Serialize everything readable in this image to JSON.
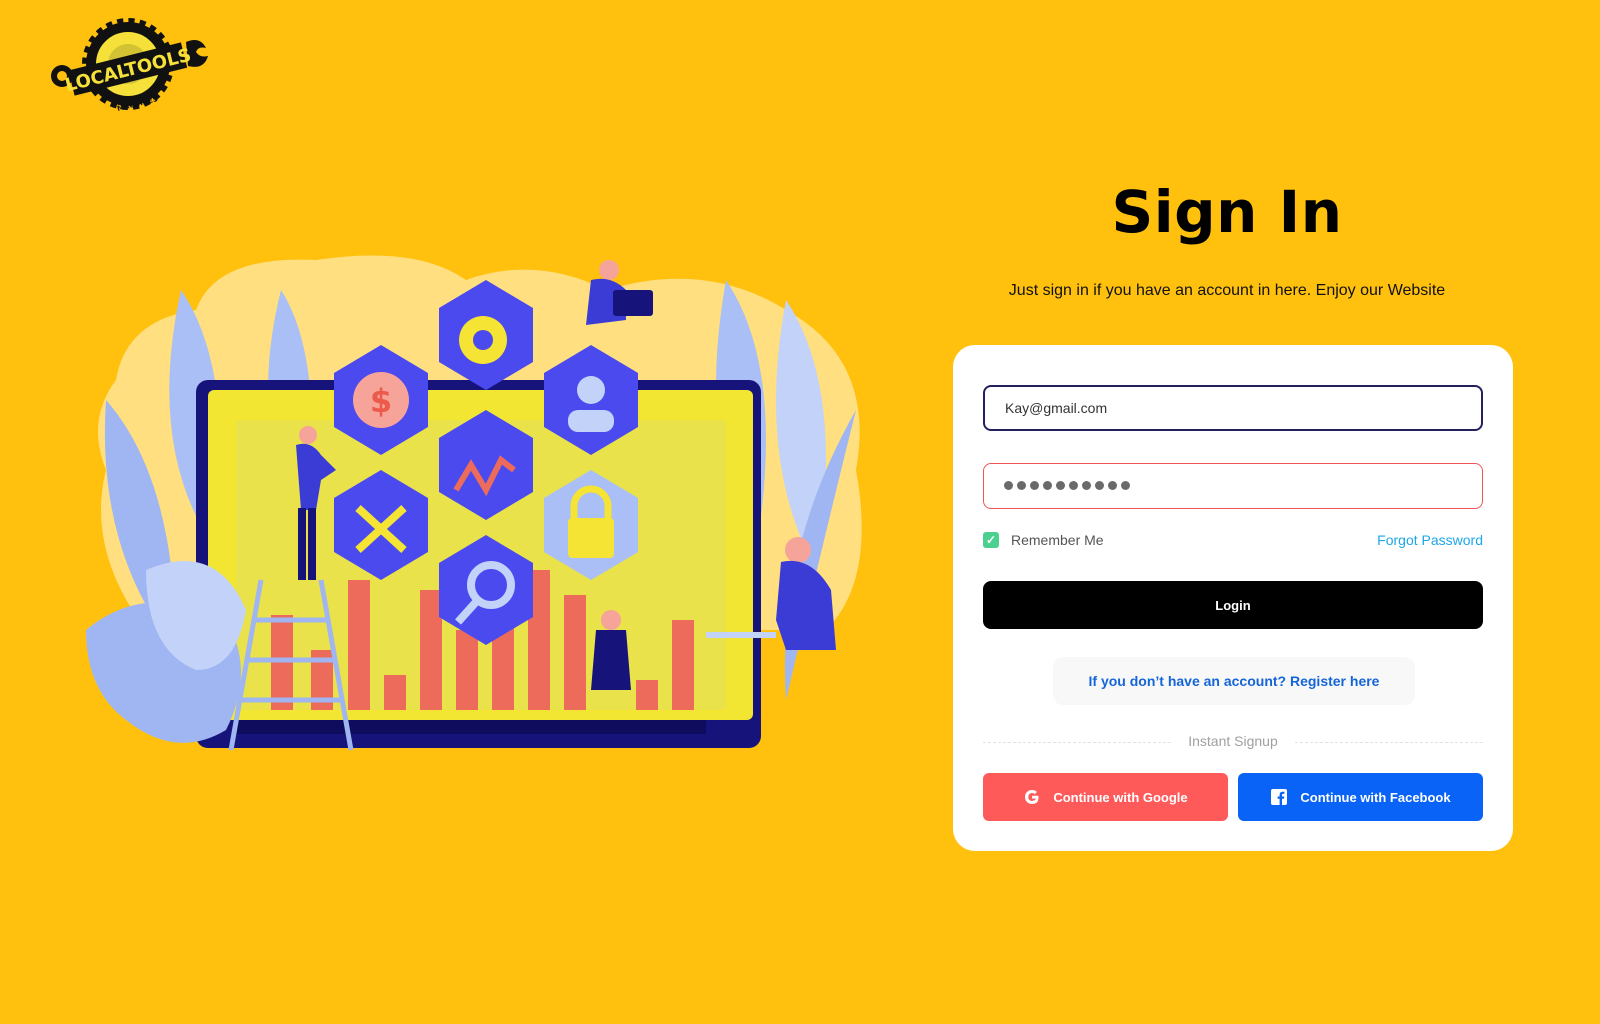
{
  "logo": {
    "text": "LOCALTOOLS",
    "subtext": "MACHINES"
  },
  "heading": {
    "title": "Sign In",
    "subtitle": "Just sign in if you have an account in here. Enjoy our Website"
  },
  "form": {
    "email_value": "Kay@gmail.com",
    "password_masked_length": 10,
    "remember_label": "Remember Me",
    "remember_checked": true,
    "forgot_label": "Forgot Password",
    "login_label": "Login",
    "register_label": "If you don’t have an account? Register here",
    "divider_label": "Instant Signup",
    "google_label": "Continue with Google",
    "facebook_label": "Continue with Facebook"
  },
  "colors": {
    "background": "#FFC10E",
    "accent_blue": "#4B4AEF",
    "google": "#FF5A5A",
    "facebook": "#0A63F7",
    "link": "#1565D8"
  },
  "icons": {
    "logo": "gear-wrench-logo",
    "check": "check-icon",
    "google": "google-icon",
    "facebook": "facebook-icon"
  }
}
